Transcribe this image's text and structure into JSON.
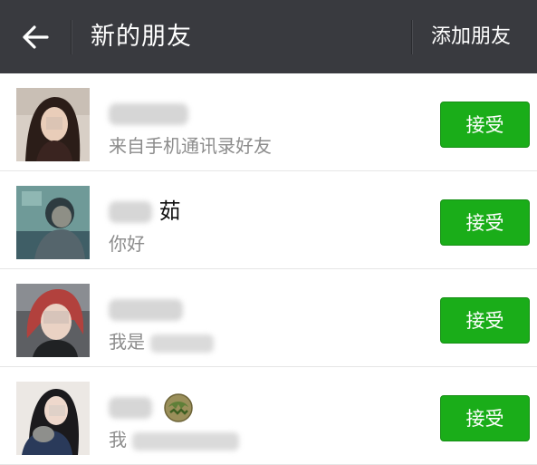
{
  "header": {
    "back_icon": "arrow-left-icon",
    "title": "新的朋友",
    "action_label": "添加朋友",
    "background": "#393a3f"
  },
  "accept_color": "#1aad19",
  "requests": [
    {
      "name_visible": "",
      "subtitle": "来自手机通讯录好友",
      "action_label": "接受"
    },
    {
      "name_visible": "茹",
      "subtitle": "你好",
      "action_label": "接受"
    },
    {
      "name_visible": "",
      "subtitle": "我是",
      "action_label": "接受"
    },
    {
      "name_visible": "",
      "name_emoji": "emoji-icon",
      "subtitle": "我",
      "action_label": "接受"
    }
  ]
}
